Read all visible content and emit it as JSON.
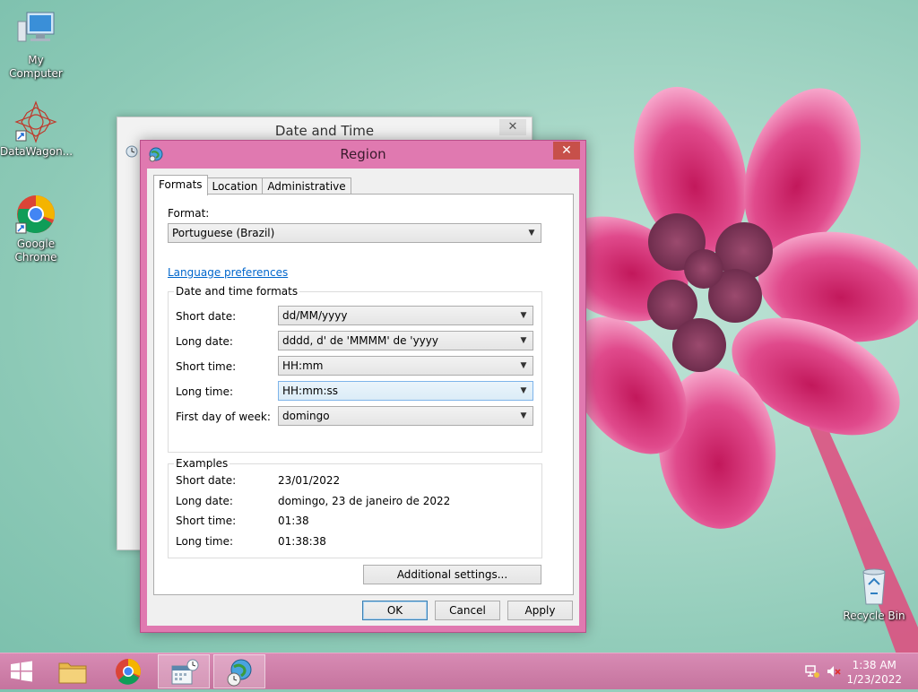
{
  "desktop": {
    "icons": [
      {
        "label": "My Computer"
      },
      {
        "label": "DataWagon..."
      },
      {
        "label": "Google Chrome"
      },
      {
        "label": "Recycle Bin"
      }
    ]
  },
  "bg_window": {
    "title": "Date and Time",
    "close": "✕"
  },
  "dialog": {
    "title": "Region",
    "close": "✕",
    "tabs": [
      {
        "label": "Formats",
        "active": true
      },
      {
        "label": "Location",
        "active": false
      },
      {
        "label": "Administrative",
        "active": false
      }
    ],
    "format_label": "Format:",
    "format_value": "Portuguese (Brazil)",
    "language_link": "Language preferences",
    "date_time_group": "Date and time formats",
    "fields": [
      {
        "label": "Short date:",
        "value": "dd/MM/yyyy"
      },
      {
        "label": "Long date:",
        "value": "dddd, d' de 'MMMM' de 'yyyy"
      },
      {
        "label": "Short time:",
        "value": "HH:mm"
      },
      {
        "label": "Long time:",
        "value": "HH:mm:ss"
      },
      {
        "label": "First day of week:",
        "value": "domingo"
      }
    ],
    "examples_group": "Examples",
    "examples": [
      {
        "label": "Short date:",
        "value": "23/01/2022"
      },
      {
        "label": "Long date:",
        "value": "domingo, 23 de janeiro de 2022"
      },
      {
        "label": "Short time:",
        "value": "01:38"
      },
      {
        "label": "Long time:",
        "value": "01:38:38"
      }
    ],
    "additional_settings": "Additional settings...",
    "ok": "OK",
    "cancel": "Cancel",
    "apply": "Apply"
  },
  "taskbar": {
    "time": "1:38 AM",
    "date": "1/23/2022"
  },
  "colors": {
    "accent": "#e079b0",
    "taskbar": "#c5749e",
    "close": "#c7504a"
  }
}
